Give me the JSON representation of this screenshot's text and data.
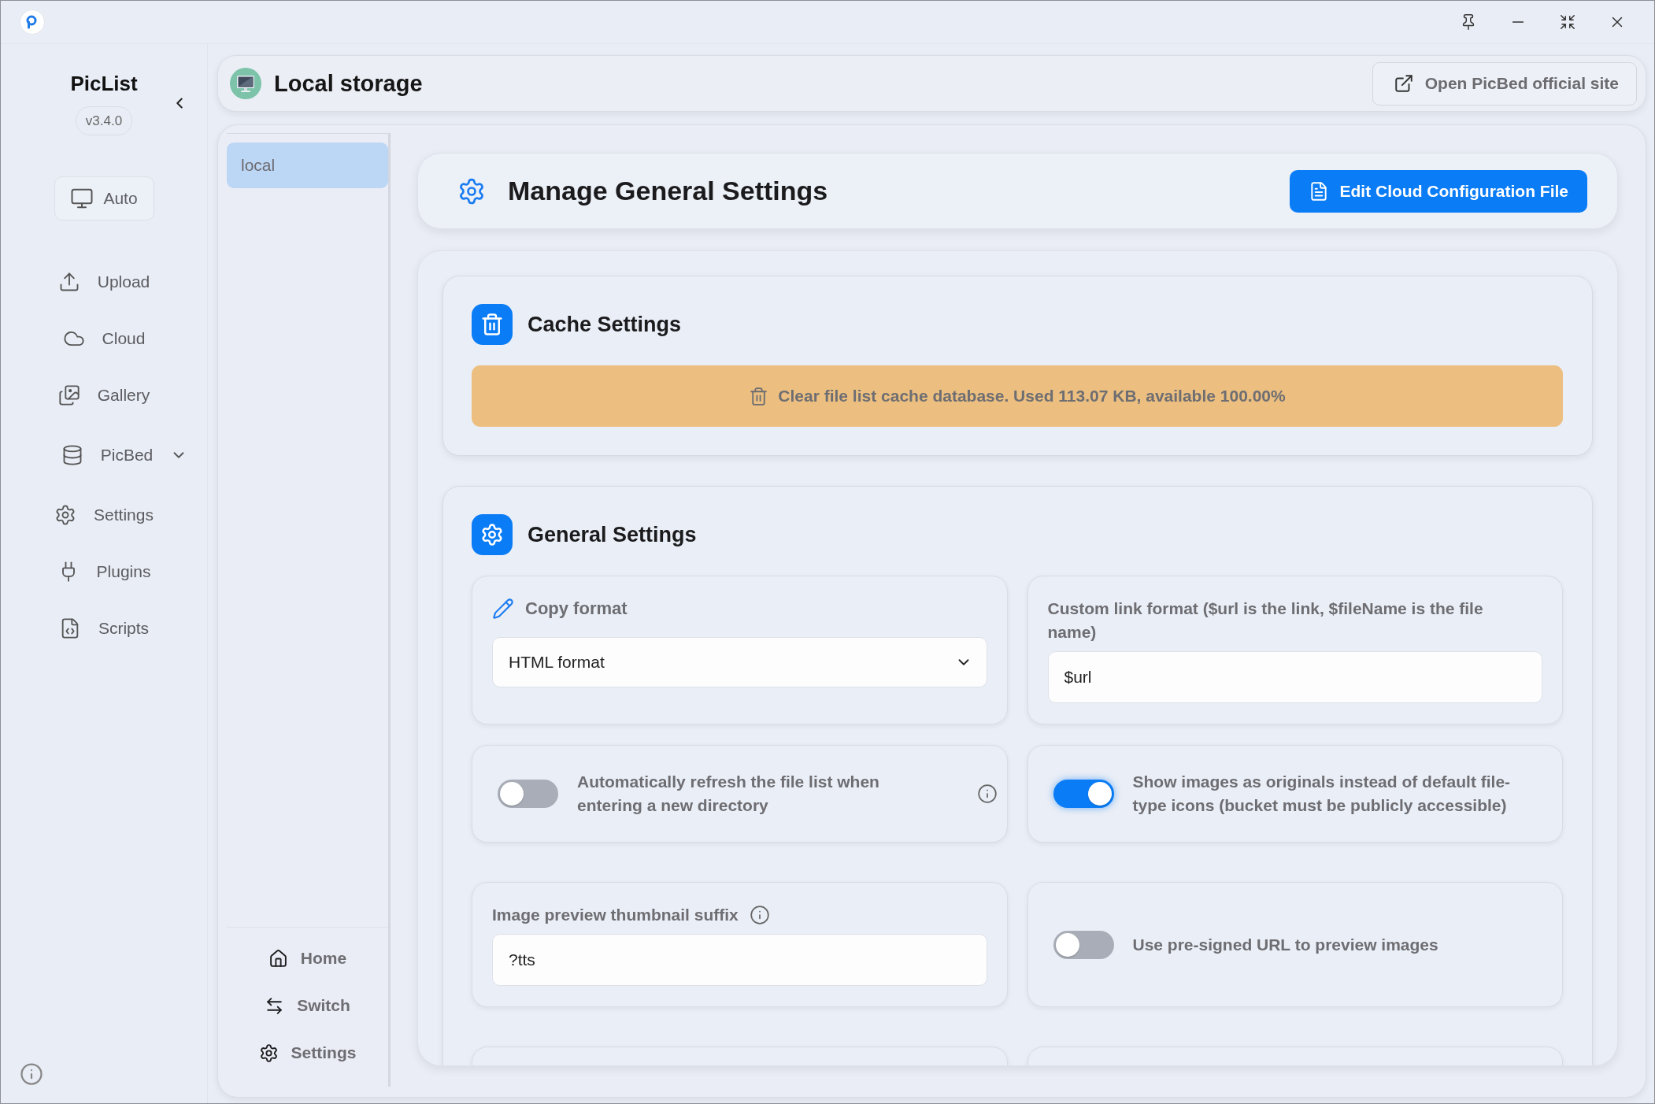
{
  "sidebar": {
    "app_name": "PicList",
    "version": "v3.4.0",
    "theme_button": "Auto",
    "items": [
      {
        "label": "Upload",
        "kind": "link"
      },
      {
        "label": "Cloud",
        "kind": "link"
      },
      {
        "label": "Gallery",
        "kind": "link"
      },
      {
        "label": "PicBed",
        "kind": "group"
      },
      {
        "label": "Settings",
        "kind": "link"
      },
      {
        "label": "Plugins",
        "kind": "link"
      },
      {
        "label": "Scripts",
        "kind": "link"
      }
    ]
  },
  "header": {
    "title": "Local storage",
    "site_button": "Open PicBed official site"
  },
  "storage_list": {
    "items": [
      {
        "label": "local",
        "selected": true
      }
    ],
    "footer": [
      "Home",
      "Switch",
      "Settings"
    ]
  },
  "manage_settings": {
    "title": "Manage General Settings",
    "button": "Edit Cloud Configuration File"
  },
  "cache_settings": {
    "title": "Cache Settings",
    "clear_button": "Clear file list cache database. Used 113.07 KB, available 100.00%"
  },
  "general_settings": {
    "title": "General Settings",
    "items": [
      {
        "kind": "select",
        "label": "Copy format",
        "value": "HTML format",
        "info": false
      },
      {
        "kind": "input",
        "label": "Custom link format ($url is the link, $fileName is the file name)",
        "value": "$url",
        "info": false
      },
      {
        "kind": "toggle",
        "label": "Automatically refresh the file list when entering a new directory",
        "on": false,
        "info": true
      },
      {
        "kind": "toggle",
        "label": "Show images as originals instead of default file-type icons (bucket must be publicly accessible)",
        "on": true,
        "info": false
      },
      {
        "kind": "input",
        "label": "Image preview thumbnail suffix",
        "value": "?tts",
        "info": true
      },
      {
        "kind": "toggle",
        "label": "Use pre-signed URL to preview images",
        "on": false,
        "info": false
      }
    ]
  }
}
